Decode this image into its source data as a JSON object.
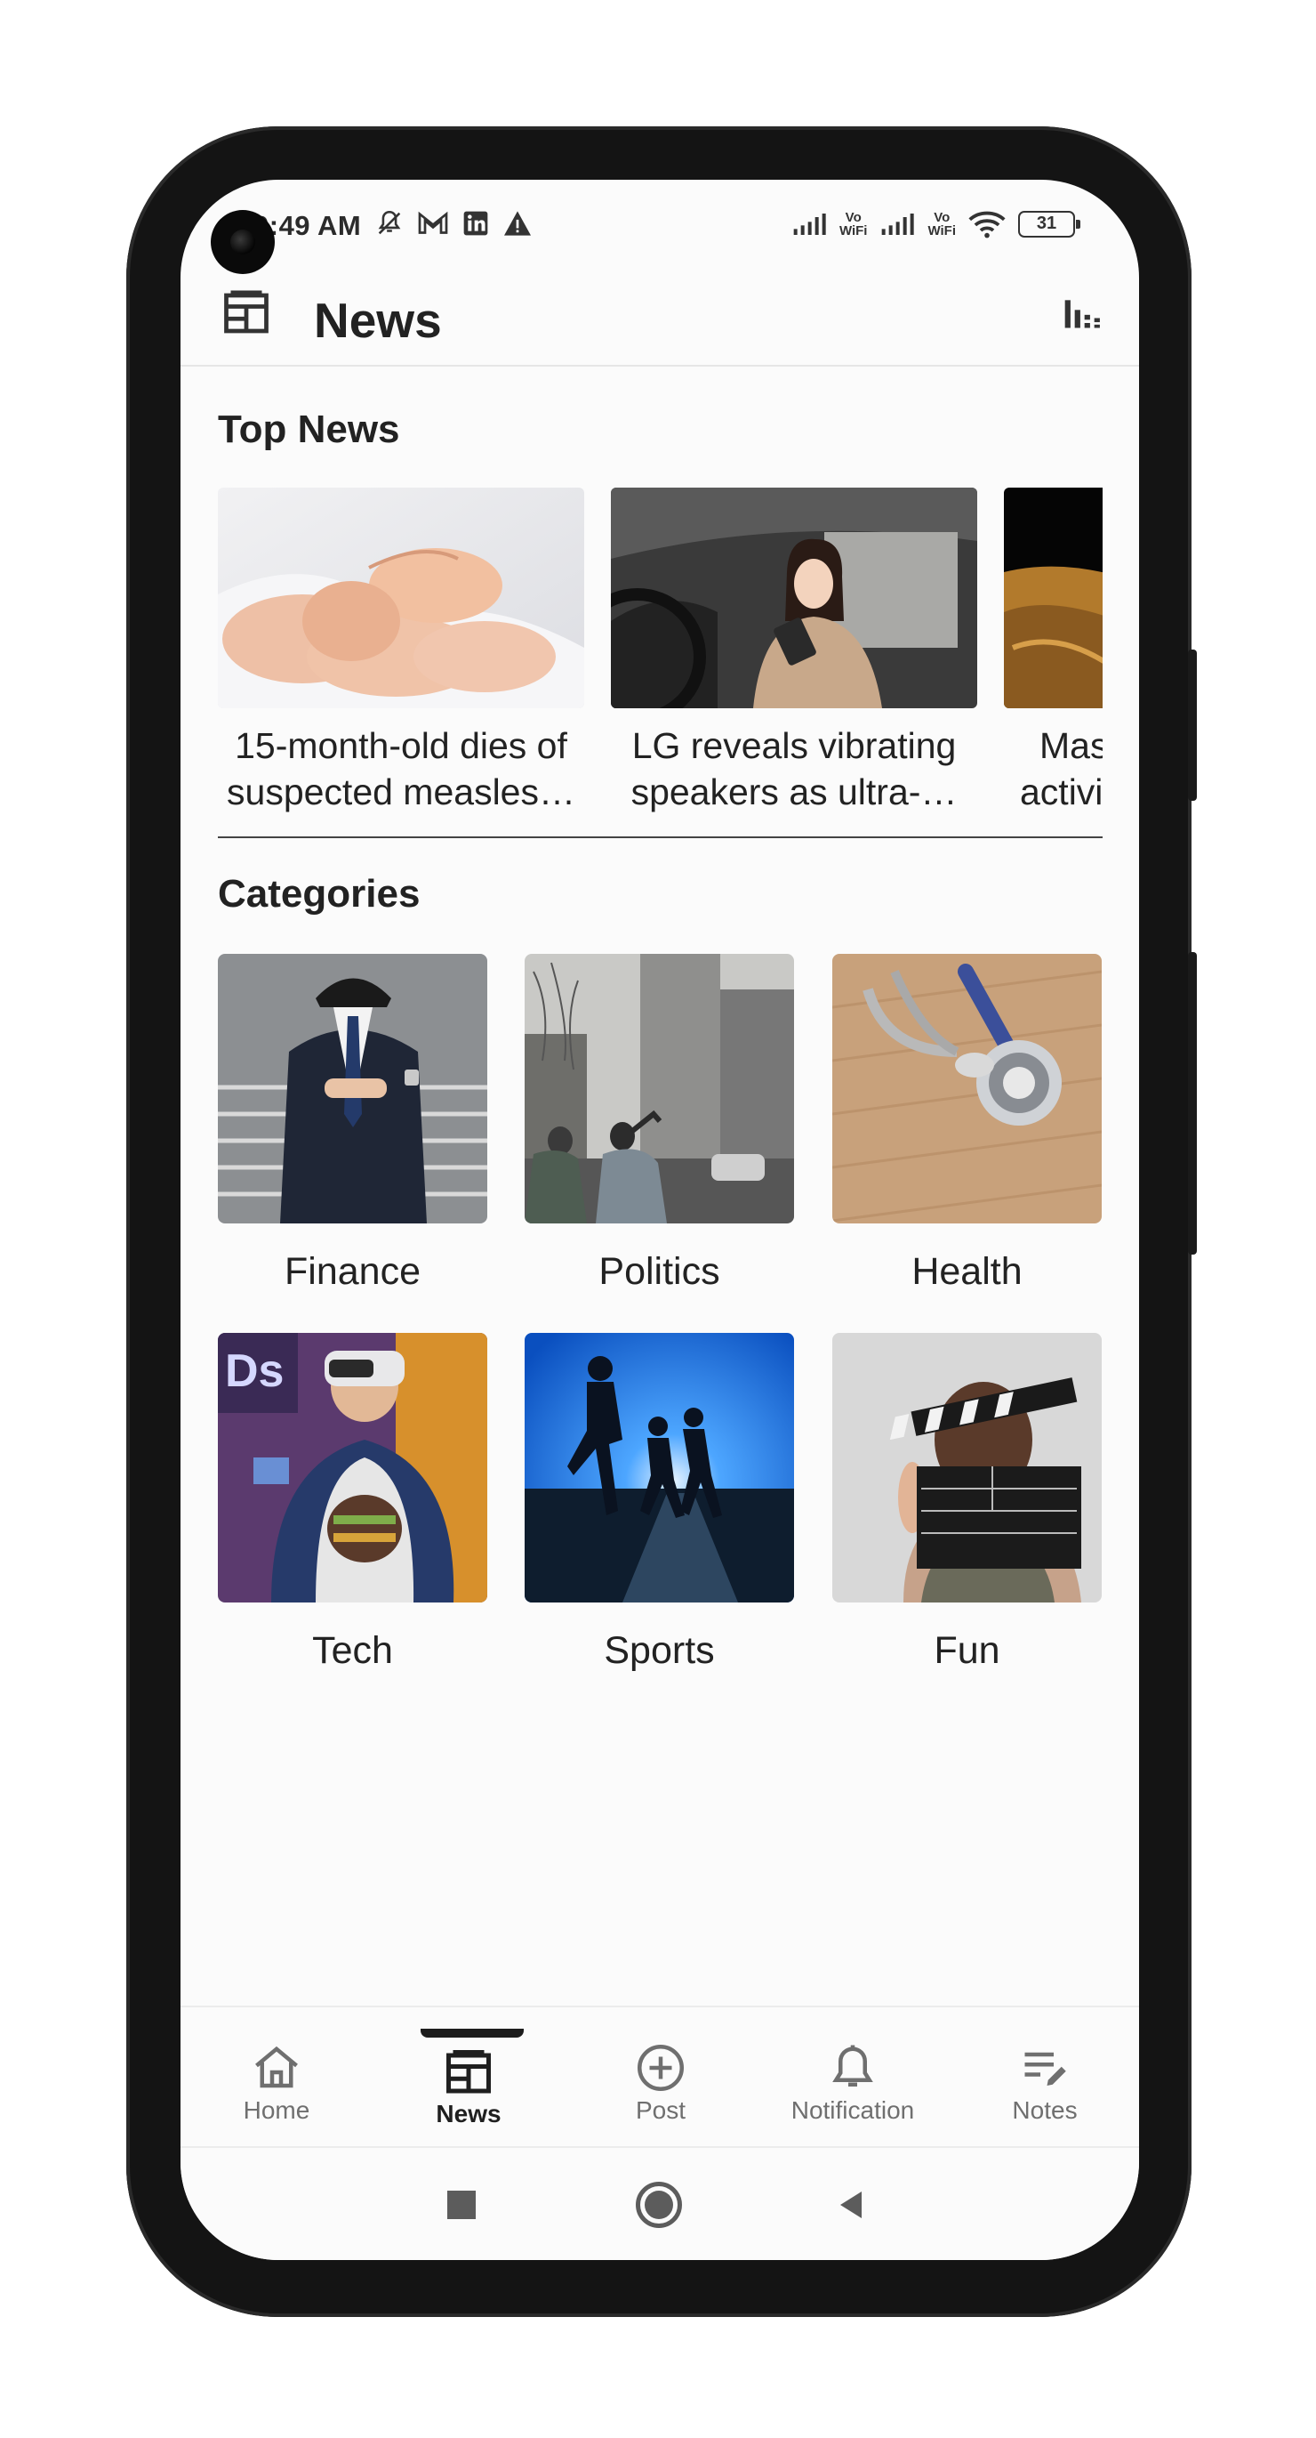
{
  "status_bar": {
    "time": "9:49 AM",
    "battery": "31",
    "left_icons": [
      "mute-bell-icon",
      "gmail-icon",
      "linkedin-icon",
      "warning-icon"
    ],
    "right_icons": [
      "signal-icon",
      "vowifi-icon",
      "signal-icon",
      "vowifi-icon",
      "wifi-icon",
      "battery-icon"
    ],
    "vowifi_top": "Vo",
    "vowifi_bottom": "WiFi"
  },
  "app_bar": {
    "title": "News",
    "leading_icon": "newspaper-icon",
    "action_icon": "chart-icon"
  },
  "top_news": {
    "title": "Top News",
    "items": [
      {
        "lines": [
          "15-month-old dies of",
          "suspected measles…"
        ]
      },
      {
        "lines": [
          "LG reveals vibrating",
          "speakers as ultra-…"
        ]
      },
      {
        "lines": [
          "Mas",
          "activi"
        ]
      }
    ]
  },
  "categories": {
    "title": "Categories",
    "items": [
      {
        "label": "Finance"
      },
      {
        "label": "Politics"
      },
      {
        "label": "Health"
      },
      {
        "label": "Tech"
      },
      {
        "label": "Sports"
      },
      {
        "label": "Fun"
      }
    ]
  },
  "bottom_nav": {
    "items": [
      {
        "label": "Home",
        "icon": "home-icon",
        "active": false
      },
      {
        "label": "News",
        "icon": "newspaper-icon",
        "active": true
      },
      {
        "label": "Post",
        "icon": "plus-circle-icon",
        "active": false
      },
      {
        "label": "Notification",
        "icon": "bell-icon",
        "active": false
      },
      {
        "label": "Notes",
        "icon": "notes-edit-icon",
        "active": false
      }
    ]
  },
  "system_nav": {
    "buttons": [
      "recents-icon",
      "home-circle-icon",
      "back-icon"
    ]
  }
}
